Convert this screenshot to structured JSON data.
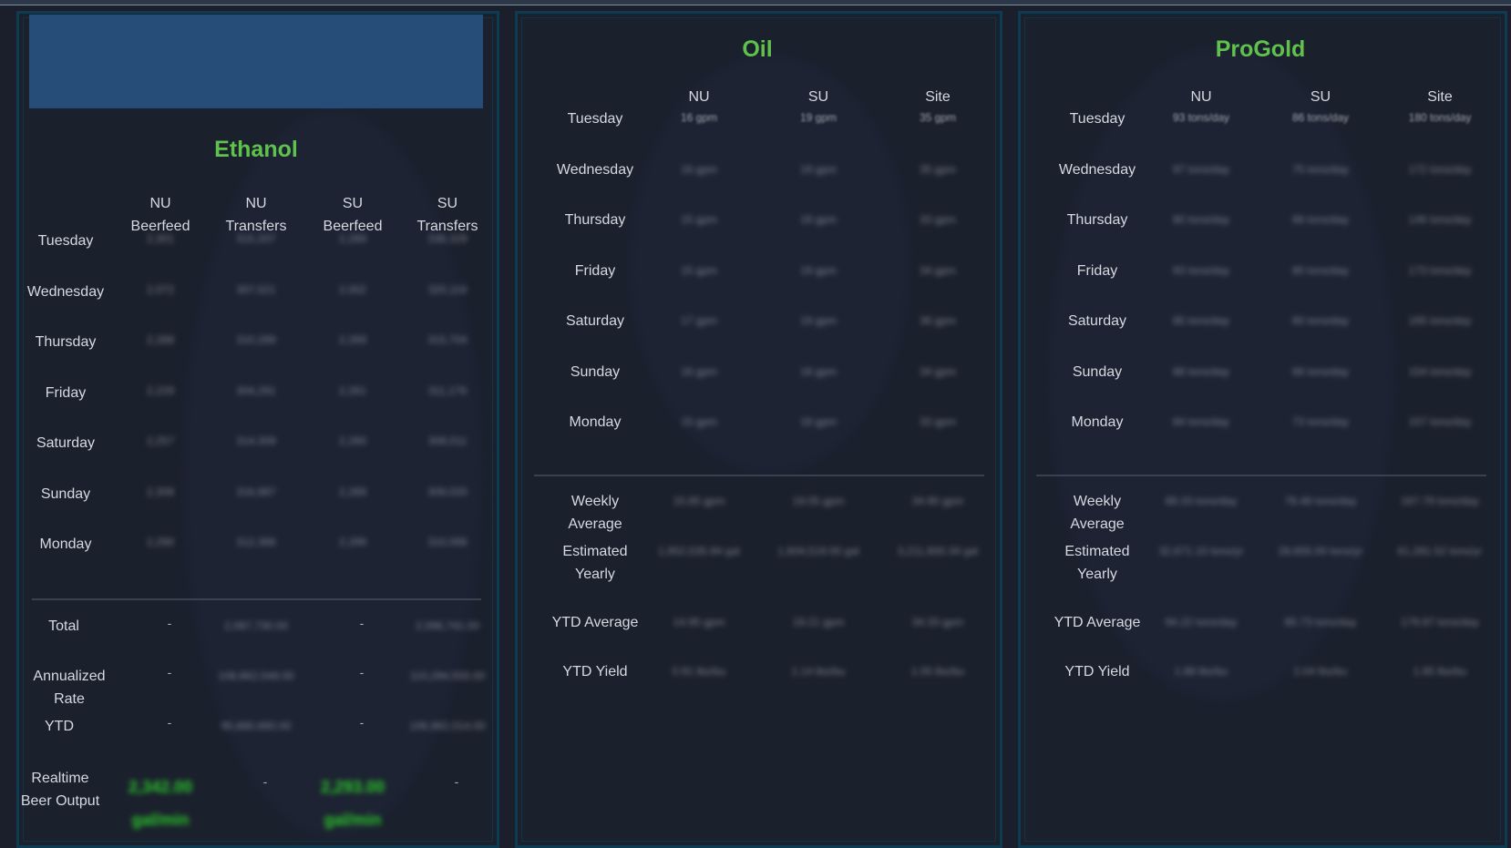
{
  "ethanol": {
    "title": "Ethanol",
    "columns": [
      {
        "l1": "NU",
        "l2": "Beerfeed"
      },
      {
        "l1": "NU",
        "l2": "Transfers"
      },
      {
        "l1": "SU",
        "l2": "Beerfeed"
      },
      {
        "l1": "SU",
        "l2": "Transfers"
      }
    ],
    "days": [
      "Tuesday",
      "Wednesday",
      "Thursday",
      "Friday",
      "Saturday",
      "Sunday",
      "Monday"
    ],
    "rows": [
      [
        "2,301",
        "315,337",
        "2,289",
        "338,329"
      ],
      [
        "2,072",
        "307,521",
        "2,002",
        "320,118"
      ],
      [
        "2,288",
        "310,289",
        "2,269",
        "315,704"
      ],
      [
        "2,229",
        "304,291",
        "2,261",
        "311,176"
      ],
      [
        "2,257",
        "314,309",
        "2,260",
        "308,011"
      ],
      [
        "2,308",
        "316,987",
        "2,289",
        "309,020"
      ],
      [
        "2,290",
        "312,366",
        "2,299",
        "310,066"
      ]
    ],
    "summary_labels": [
      "Total",
      "Annualized Rate",
      "YTD"
    ],
    "summary": [
      [
        "-",
        "2,087,730.00",
        "-",
        "2,096,741.00"
      ],
      [
        "-",
        "108,862,548.00",
        "-",
        "110,294,555.00"
      ],
      [
        "-",
        "95,880,660.00",
        "-",
        "106,982,014.00"
      ]
    ],
    "realtime_label": "Realtime Beer Output",
    "realtime": [
      "2,342.00 gal/min",
      "-",
      "2,293.00 gal/min",
      "-"
    ]
  },
  "oil": {
    "title": "Oil",
    "columns": [
      {
        "l1": "NU",
        "l2": "16 gpm"
      },
      {
        "l1": "SU",
        "l2": "19 gpm"
      },
      {
        "l1": "Site",
        "l2": "35 gpm"
      }
    ],
    "days": [
      "Tuesday",
      "Wednesday",
      "Thursday",
      "Friday",
      "Saturday",
      "Sunday",
      "Monday"
    ],
    "rows": [
      [
        "16 gpm",
        "19 gpm",
        "35 gpm"
      ],
      [
        "16 gpm",
        "19 gpm",
        "35 gpm"
      ],
      [
        "15 gpm",
        "18 gpm",
        "33 gpm"
      ],
      [
        "15 gpm",
        "19 gpm",
        "34 gpm"
      ],
      [
        "17 gpm",
        "19 gpm",
        "36 gpm"
      ],
      [
        "16 gpm",
        "18 gpm",
        "34 gpm"
      ],
      [
        "15 gpm",
        "18 gpm",
        "33 gpm"
      ]
    ],
    "summary_labels": [
      "Weekly Average",
      "Estimated Yearly",
      "YTD Average",
      "YTD Yield"
    ],
    "summary": [
      [
        "15.85 gpm",
        "19.05 gpm",
        "34.90 gpm"
      ],
      [
        "1,952,535.94 gal",
        "1,604,519.00 gal",
        "3,211,600.34 gal"
      ],
      [
        "14.95 gpm",
        "19.21 gpm",
        "34.33 gpm"
      ],
      [
        "0.91 lbs/bu",
        "1.14 lbs/bu",
        "1.05 lbs/bu"
      ]
    ]
  },
  "progold": {
    "title": "ProGold",
    "columns": [
      {
        "l1": "NU",
        "l2": "93 tons/day"
      },
      {
        "l1": "SU",
        "l2": "86 tons/day"
      },
      {
        "l1": "Site",
        "l2": "180 tons/day"
      }
    ],
    "days": [
      "Tuesday",
      "Wednesday",
      "Thursday",
      "Friday",
      "Saturday",
      "Sunday",
      "Monday"
    ],
    "rows": [
      [
        "93 tons/day",
        "86 tons/day",
        "180 tons/day"
      ],
      [
        "97 tons/day",
        "75 tons/day",
        "172 tons/day"
      ],
      [
        "80 tons/day",
        "66 tons/day",
        "146 tons/day"
      ],
      [
        "93 tons/day",
        "80 tons/day",
        "173 tons/day"
      ],
      [
        "85 tons/day",
        "80 tons/day",
        "165 tons/day"
      ],
      [
        "88 tons/day",
        "66 tons/day",
        "154 tons/day"
      ],
      [
        "84 tons/day",
        "73 tons/day",
        "157 tons/day"
      ]
    ],
    "summary_labels": [
      "Weekly Average",
      "Estimated Yearly",
      "YTD Average",
      "YTD Yield"
    ],
    "summary": [
      [
        "89.33 tons/day",
        "78.48 tons/day",
        "167.79 tons/day"
      ],
      [
        "32,671.10 tons/yr",
        "28,655.00 tons/yr",
        "61,281.52 tons/yr"
      ],
      [
        "94.22 tons/day",
        "85.73 tons/day",
        "179.97 tons/day"
      ],
      [
        "1.88 lbs/bu",
        "2.04 lbs/bu",
        "1.95 lbs/bu"
      ]
    ]
  }
}
